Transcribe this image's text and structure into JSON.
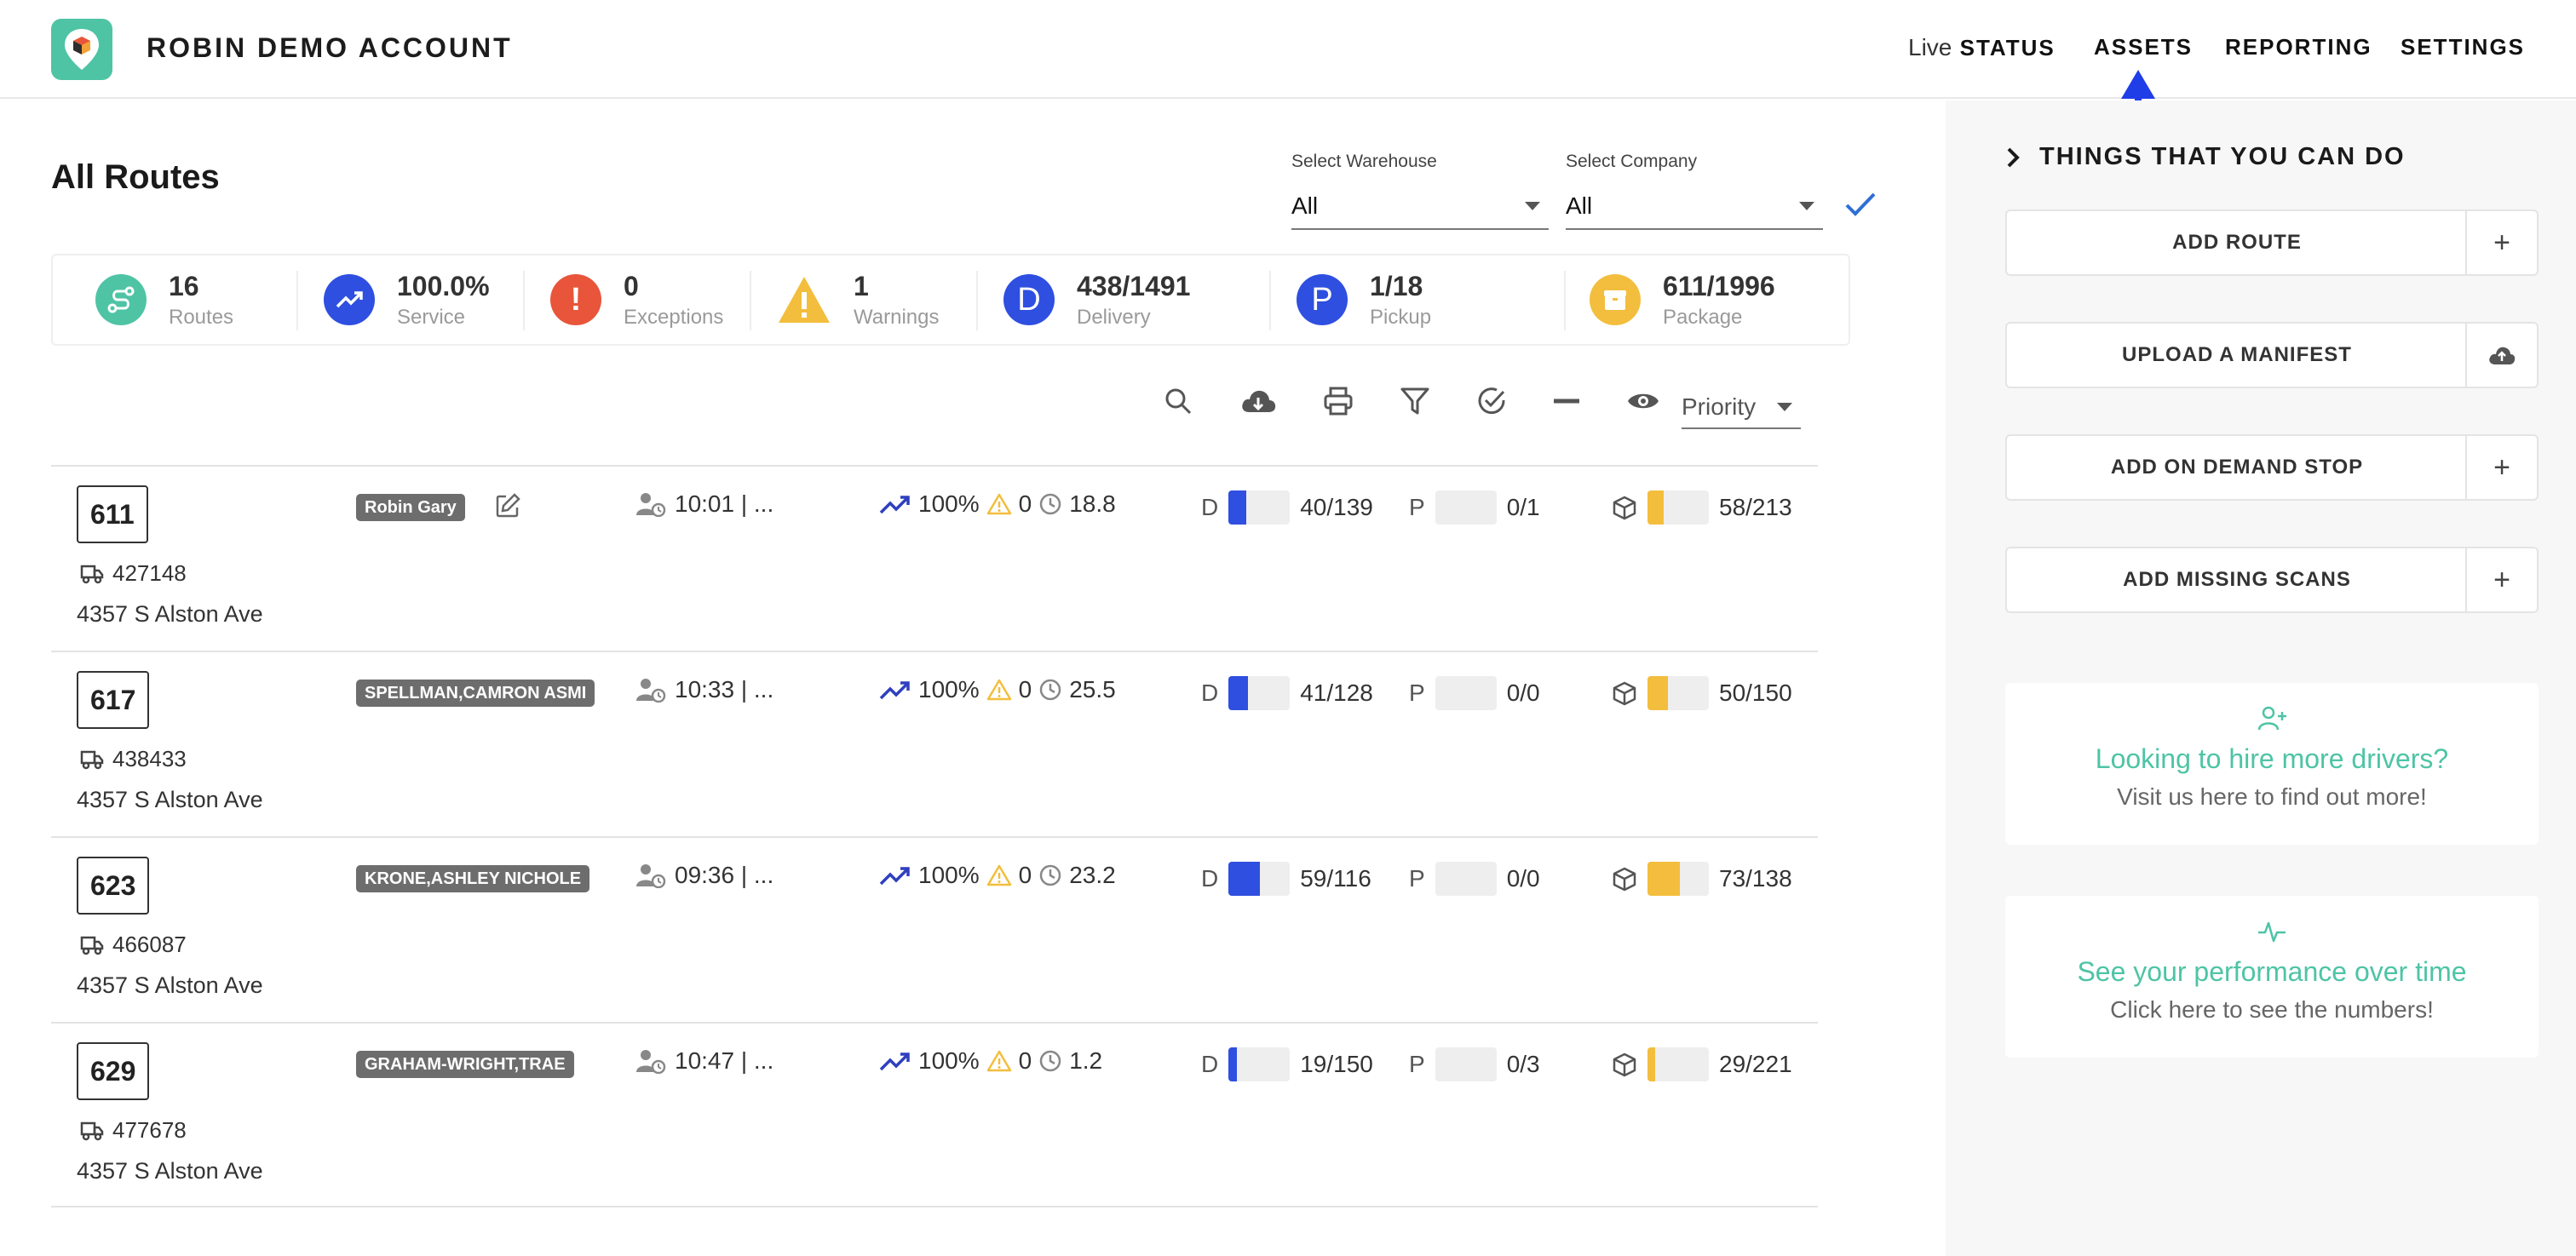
{
  "app": {
    "brand": "ROBIN DEMO ACCOUNT"
  },
  "nav": {
    "live_prefix": "Live",
    "live_status": "STATUS",
    "assets": "ASSETS",
    "reporting": "REPORTING",
    "settings": "SETTINGS"
  },
  "page": {
    "title": "All Routes"
  },
  "filters": {
    "warehouse": {
      "label": "Select Warehouse",
      "value": "All"
    },
    "company": {
      "label": "Select Company",
      "value": "All"
    }
  },
  "stats": [
    {
      "value": "16",
      "label": "Routes",
      "color": "#4ec4a5",
      "icon": "route-icon"
    },
    {
      "value": "100.0%",
      "label": "Service",
      "color": "#2f4fe0",
      "icon": "trend-up-icon"
    },
    {
      "value": "0",
      "label": "Exceptions",
      "color": "#e8553a",
      "icon": "exclamation-icon"
    },
    {
      "value": "1",
      "label": "Warnings",
      "color": "#f3be3d",
      "icon": "warning-icon"
    },
    {
      "value": "438/1491",
      "label": "Delivery",
      "color": "#2f4fe0",
      "icon_letter": "D"
    },
    {
      "value": "1/18",
      "label": "Pickup",
      "color": "#2f4fe0",
      "icon_letter": "P"
    },
    {
      "value": "611/1996",
      "label": "Package",
      "color": "#f3be3d",
      "icon": "package-icon"
    }
  ],
  "toolbar": {
    "sort": "Priority"
  },
  "routes": [
    {
      "number": "611",
      "vehicle": "427148",
      "address": "4357 S Alston Ave",
      "driver": "Robin Gary",
      "time": "10:01 | ...",
      "service": "100%",
      "warnings": "0",
      "duration": "18.8",
      "delivery_letter": "D",
      "delivery": "40/139",
      "delivery_frac": 0.29,
      "pickup_letter": "P",
      "pickup": "0/1",
      "pickup_frac": 0,
      "packages": "58/213",
      "package_frac": 0.27
    },
    {
      "number": "617",
      "vehicle": "438433",
      "address": "4357 S Alston Ave",
      "driver": "SPELLMAN,CAMRON ASMI",
      "time": "10:33 | ...",
      "service": "100%",
      "warnings": "0",
      "duration": "25.5",
      "delivery_letter": "D",
      "delivery": "41/128",
      "delivery_frac": 0.32,
      "pickup_letter": "P",
      "pickup": "0/0",
      "pickup_frac": 0,
      "packages": "50/150",
      "package_frac": 0.33
    },
    {
      "number": "623",
      "vehicle": "466087",
      "address": "4357 S Alston Ave",
      "driver": "KRONE,ASHLEY NICHOLE",
      "time": "09:36 | ...",
      "service": "100%",
      "warnings": "0",
      "duration": "23.2",
      "delivery_letter": "D",
      "delivery": "59/116",
      "delivery_frac": 0.51,
      "pickup_letter": "P",
      "pickup": "0/0",
      "pickup_frac": 0,
      "packages": "73/138",
      "package_frac": 0.53
    },
    {
      "number": "629",
      "vehicle": "477678",
      "address": "4357 S Alston Ave",
      "driver": "GRAHAM-WRIGHT,TRAE",
      "time": "10:47 | ...",
      "service": "100%",
      "warnings": "0",
      "duration": "1.2",
      "delivery_letter": "D",
      "delivery": "19/150",
      "delivery_frac": 0.13,
      "pickup_letter": "P",
      "pickup": "0/3",
      "pickup_frac": 0,
      "packages": "29/221",
      "package_frac": 0.13
    }
  ],
  "sidebar": {
    "title": "THINGS THAT YOU CAN DO",
    "actions": [
      {
        "label": "ADD ROUTE",
        "icon": "plus-icon"
      },
      {
        "label": "UPLOAD A MANIFEST",
        "icon": "cloud-upload-icon"
      },
      {
        "label": "ADD ON DEMAND STOP",
        "icon": "plus-icon"
      },
      {
        "label": "ADD MISSING SCANS",
        "icon": "plus-icon"
      }
    ],
    "cards": [
      {
        "title": "Looking to hire more drivers?",
        "subtitle": "Visit us here to find out more!",
        "icon": "add-user-icon"
      },
      {
        "title": "See your performance over time",
        "subtitle": "Click here to see the numbers!",
        "icon": "activity-icon"
      }
    ]
  },
  "colors": {
    "accent": "#4ec4a5",
    "blue": "#2f4fe0",
    "yellow": "#f3be3d",
    "red": "#e8553a"
  }
}
